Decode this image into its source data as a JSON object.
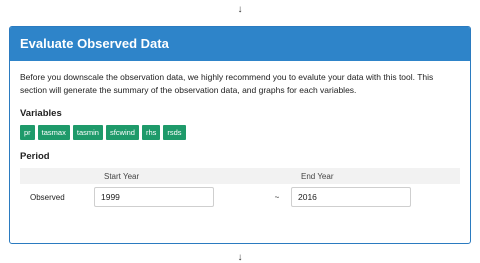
{
  "flow": {
    "top_arrow": "↓",
    "bottom_arrow": "↓"
  },
  "panel": {
    "title": "Evaluate Observed Data",
    "description": "Before you downscale the observation data, we highly recommend you to evalute your data with this tool. This section will generate the summary of the observation data, and graphs for each variables.",
    "variables_title": "Variables",
    "variables": [
      "pr",
      "tasmax",
      "tasmin",
      "sfcwind",
      "rhs",
      "rsds"
    ],
    "period_title": "Period",
    "period": {
      "header_start": "Start Year",
      "header_end": "End Year",
      "row_label": "Observed",
      "start_year": "1999",
      "separator": "~",
      "end_year": "2016"
    }
  },
  "colors": {
    "header_bg": "#2e84c9",
    "badge_bg": "#1e9a6a"
  }
}
